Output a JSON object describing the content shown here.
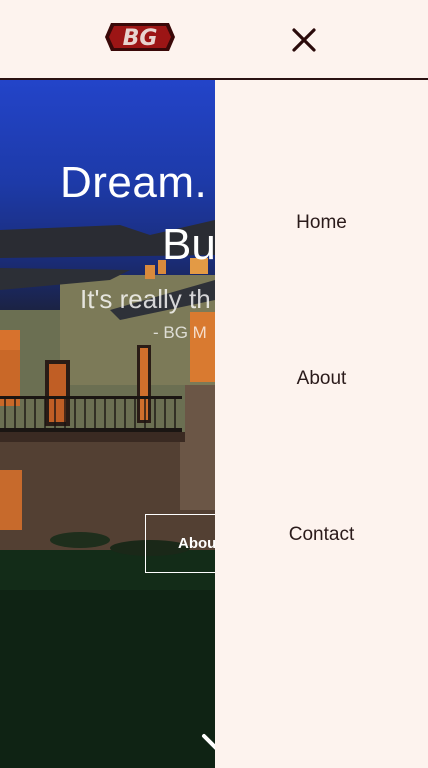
{
  "header": {
    "logo_text": "BG",
    "close_icon": "close-icon"
  },
  "hero": {
    "title_line1": "Dream.",
    "title_line2": "Bu",
    "tagline": "It's really th",
    "author": "- BG M",
    "about_button": "Abou",
    "scroll_icon": "chevron-down-icon"
  },
  "menu": {
    "items": [
      {
        "label": "Home"
      },
      {
        "label": "About"
      },
      {
        "label": "Contact"
      }
    ]
  },
  "colors": {
    "brand": "#8b1414",
    "background": "#fdf3ee",
    "text_dark": "#2a1a1a",
    "sky": "#2344c9"
  }
}
